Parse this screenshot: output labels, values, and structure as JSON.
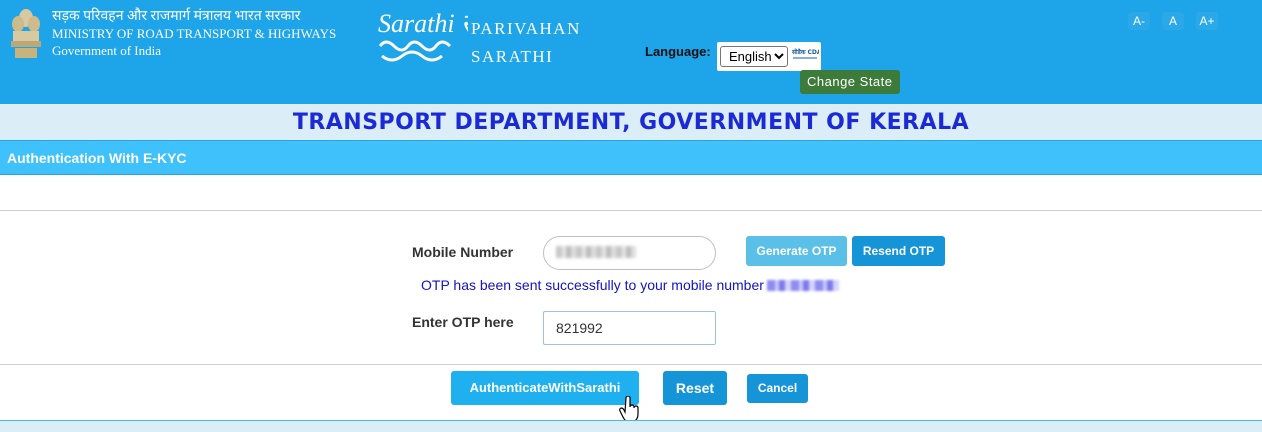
{
  "header": {
    "ministry_hindi": "सड़क परिवहन और राजमार्ग मंत्रालय भारत सरकार",
    "ministry_english": "MINISTRY OF ROAD TRANSPORT & HIGHWAYS",
    "government": "Government of India",
    "logo_text": "Sarathi सारथी",
    "brand_line1": "PARIVAHAN",
    "brand_line2": "SARATHI",
    "language_label": "Language:",
    "language_selected": "English",
    "cdac_text": "सीडैक CDAC",
    "change_state": "Change State",
    "font_controls": [
      "A-",
      "A",
      "A+"
    ],
    "colors": {
      "header_bg": "#1ea4e9",
      "change_state_bg": "#3d7b3a"
    }
  },
  "department": {
    "title": "TRANSPORT DEPARTMENT, GOVERNMENT OF KERALA"
  },
  "section": {
    "title": "Authentication With E-KYC"
  },
  "form": {
    "mobile_label": "Mobile Number",
    "generate_otp": "Generate OTP",
    "resend_otp": "Resend OTP",
    "otp_message": "OTP has been sent successfully to your mobile number",
    "otp_label": "Enter OTP here",
    "otp_value": "821992"
  },
  "actions": {
    "authenticate": "AuthenticateWithSarathi",
    "reset": "Reset",
    "cancel": "Cancel"
  }
}
